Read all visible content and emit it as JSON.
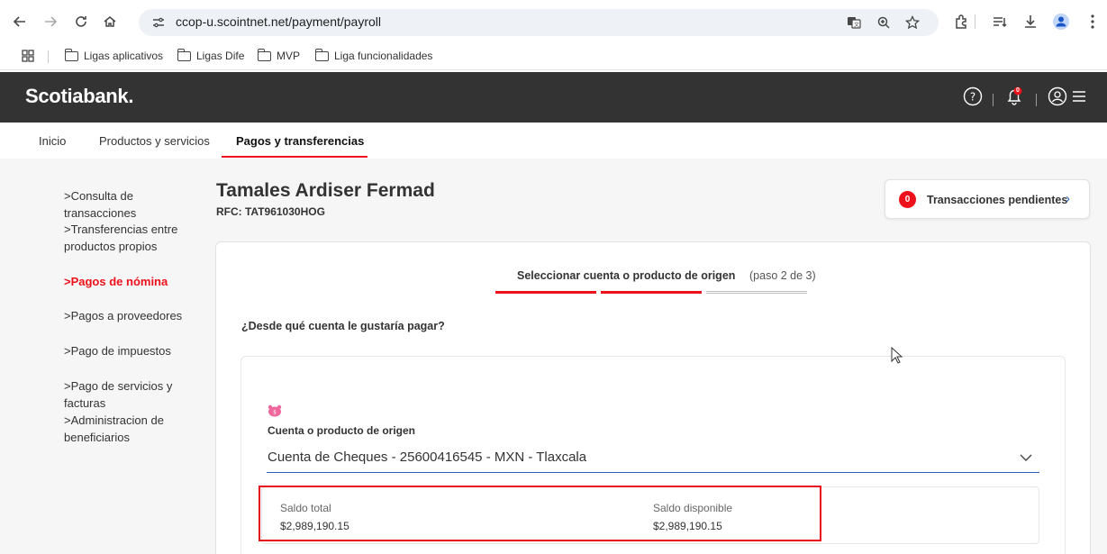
{
  "browser": {
    "url": "ccop-u.scointnet.net/payment/payroll",
    "bookmarks": [
      "Ligas aplicativos",
      "Ligas Dife",
      "MVP",
      "Liga funcionalidades"
    ]
  },
  "header": {
    "logo": "Scotiabank.",
    "notification_count": "0",
    "brand_color": "#ec111a"
  },
  "nav": {
    "items": [
      "Inicio",
      "Productos y servicios",
      "Pagos y transferencias"
    ],
    "active_index": 2
  },
  "sidebar": {
    "items": [
      {
        "label": "Consulta de transacciones"
      },
      {
        "label": "Transferencias entre productos propios"
      },
      {
        "label": "Pagos de nómina",
        "active": true
      },
      {
        "label": "Pagos a proveedores"
      },
      {
        "label": "Pago de impuestos"
      },
      {
        "label": "Pago de servicios y facturas"
      },
      {
        "label": "Administracion de beneficiarios"
      }
    ]
  },
  "page": {
    "company": "Tamales Ardiser Fermad",
    "rfc": "RFC: TAT961030HOG",
    "pending_count": "0",
    "pending_label": "Transacciones pendientes"
  },
  "stepper": {
    "label": "Seleccionar cuenta o producto de origen",
    "count": "(paso 2 de 3)",
    "current_step": 2,
    "total_steps": 3
  },
  "form": {
    "question": "¿Desde qué cuenta le gustaría pagar?",
    "field_label": "Cuenta o producto de origen",
    "selected_account": "Cuenta de Cheques - 25600416545 - MXN - Tlaxcala"
  },
  "balances": {
    "total_label": "Saldo total",
    "total_value": "$2,989,190.15",
    "available_label": "Saldo disponible",
    "available_value": "$2,989,190.15"
  }
}
